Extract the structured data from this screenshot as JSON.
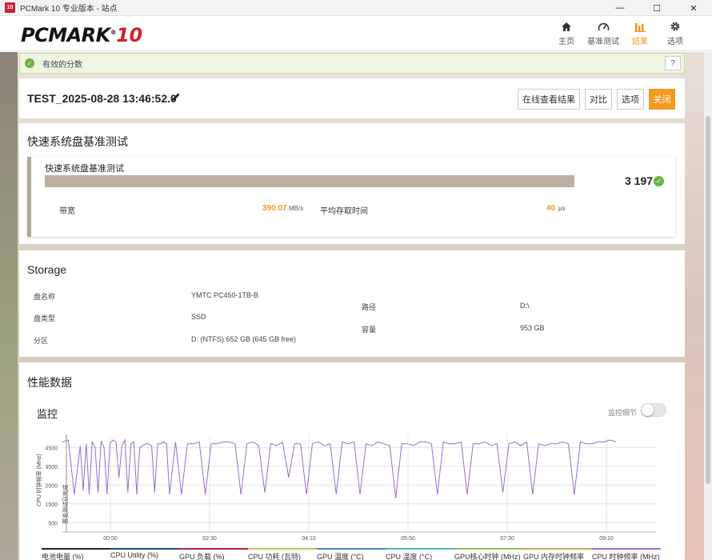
{
  "window": {
    "title": "PCMark 10 专业版本 - 站点",
    "app_icon_text": "10",
    "controls": {
      "minimize": "—",
      "maximize": "☐",
      "close": "✕"
    }
  },
  "header": {
    "logo_main": "PCMARK",
    "logo_num": "10",
    "logo_mark": "®",
    "nav": [
      {
        "label": "主页",
        "icon": "home-icon"
      },
      {
        "label": "基准测试",
        "icon": "gauge-icon"
      },
      {
        "label": "结果",
        "icon": "bar-chart-icon",
        "active": true
      },
      {
        "label": "选项",
        "icon": "gear-icon"
      }
    ]
  },
  "notice": {
    "text": "有效的分数",
    "help": "?"
  },
  "test": {
    "name": "TEST_2025-08-28 13:46:52.0",
    "buttons": {
      "online": "在线查看结果",
      "compare": "对比",
      "options": "选项",
      "close": "关闭"
    }
  },
  "benchmark": {
    "section_title": "快速系统盘基准测试",
    "card_title": "快速系统盘基准测试",
    "score": "3 197",
    "bandwidth_label": "带宽",
    "bandwidth_value": "390.07",
    "bandwidth_unit": "MB/s",
    "latency_label": "平均存取时间",
    "latency_value": "40",
    "latency_unit": "μs"
  },
  "storage": {
    "title": "Storage",
    "disk_name_label": "盘名称",
    "disk_name_value": "YMTC PC450-1TB-B",
    "disk_type_label": "盘类型",
    "disk_type_value": "SSD",
    "partition_label": "分区",
    "partition_value": "D: (NTFS) 652 GB (645 GB free)",
    "path_label": "路径",
    "path_value": "D:\\",
    "capacity_label": "容量",
    "capacity_value": "953 GB"
  },
  "performance": {
    "title": "性能数据",
    "monitor_title": "监控",
    "toggle_label": "监控细节",
    "toggle_on": false
  },
  "chart_data": {
    "type": "line",
    "ylabel": "CPU 时钟频率 (MHz)",
    "secondary_label": "基准测试已完成",
    "yticks": [
      500,
      1500,
      2500,
      3500,
      4500
    ],
    "xticks": [
      "00:50",
      "02:30",
      "04:10",
      "05:50",
      "07:30",
      "09:10"
    ],
    "ylim": [
      0,
      5200
    ],
    "series": [
      {
        "name": "CPU 时钟频率 (MHz)",
        "color": "#9b6fc9",
        "x": [
          0,
          0.1,
          0.2,
          0.3,
          0.35,
          0.4,
          0.45,
          0.5,
          0.55,
          0.6,
          0.65,
          0.7,
          0.75,
          0.8,
          0.85,
          0.9,
          0.95,
          1.0,
          1.05,
          1.1,
          1.15,
          1.2,
          1.25,
          1.3,
          1.35,
          1.4,
          1.45,
          1.5,
          1.55,
          1.6,
          1.65,
          1.7,
          1.75,
          1.8,
          1.9,
          2.0,
          2.1,
          2.2,
          2.3,
          2.4,
          2.5,
          2.6,
          2.7,
          2.8,
          2.9,
          3.0,
          3.1,
          3.2,
          3.3,
          3.4,
          3.5,
          3.6,
          3.7,
          3.8,
          3.9,
          4.0,
          4.1,
          4.2,
          4.3,
          4.4,
          4.5,
          4.6,
          4.7,
          4.8,
          4.9,
          5.0,
          5.1,
          5.2,
          5.3,
          5.4,
          5.5,
          5.6,
          5.7,
          5.8,
          5.9,
          6.0,
          6.1,
          6.2,
          6.3,
          6.4,
          6.5,
          6.6,
          6.7,
          6.8,
          6.9,
          7.0,
          7.1,
          7.2,
          7.3,
          7.4,
          7.5,
          7.6,
          7.7,
          7.8,
          7.9,
          8.0,
          8.1,
          8.2,
          8.3,
          8.4,
          8.5,
          8.6,
          8.7,
          8.8,
          8.9,
          9.0,
          9.1,
          9.2,
          9.3
        ],
        "values": [
          4800,
          4900,
          2000,
          4600,
          2200,
          4700,
          2000,
          4800,
          4500,
          2100,
          4850,
          4500,
          2000,
          4700,
          4900,
          4800,
          2900,
          4600,
          4900,
          2100,
          4700,
          4800,
          2000,
          4500,
          4600,
          4700,
          4700,
          4600,
          2100,
          4700,
          4700,
          4800,
          4700,
          2000,
          4800,
          2000,
          4700,
          4700,
          4800,
          2000,
          4700,
          4700,
          4800,
          4800,
          4700,
          2000,
          4700,
          4800,
          4600,
          2100,
          4700,
          4600,
          4800,
          2900,
          4700,
          4700,
          2000,
          4700,
          4800,
          4600,
          4700,
          2000,
          4800,
          4700,
          4800,
          2000,
          4700,
          4600,
          4800,
          4700,
          4600,
          1800,
          4700,
          4700,
          4600,
          4800,
          4800,
          4700,
          2000,
          4800,
          4700,
          4700,
          4800,
          2000,
          4700,
          4700,
          4800,
          4600,
          4700,
          2100,
          4700,
          4800,
          4600,
          4800,
          2000,
          4700,
          4600,
          4700,
          4700,
          4800,
          4700,
          2000,
          4800,
          4700,
          4700,
          4800,
          4800,
          4900,
          4800
        ]
      }
    ],
    "legend": [
      {
        "name": "电池电量 (%)",
        "color": "#1b2a2a"
      },
      {
        "name": "CPU Utility (%)",
        "color": "#1c4f7a"
      },
      {
        "name": "GPU 负载 (%)",
        "color": "#b5223a"
      },
      {
        "name": "CPU 功耗 (瓦特)",
        "color": "#c8c060"
      },
      {
        "name": "GPU 温度 (°C)",
        "color": "#4a86b7"
      },
      {
        "name": "CPU 温度 (°C)",
        "color": "#4bb6b0"
      },
      {
        "name": "GPU核心时钟 (MHz)",
        "color": "#8bbf58"
      },
      {
        "name": "GPU 内存时钟频率",
        "color": "#c9a86a"
      },
      {
        "name": "CPU 时钟频率 (MHz)",
        "color": "#9b6fc9"
      }
    ]
  }
}
